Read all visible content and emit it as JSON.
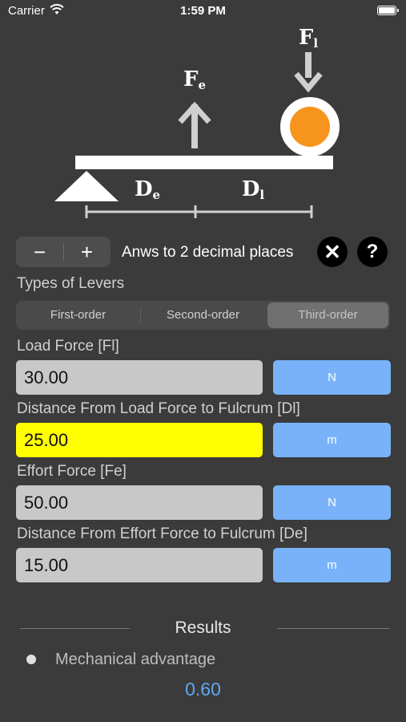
{
  "status_bar": {
    "carrier": "Carrier",
    "time": "1:59 PM"
  },
  "diagram": {
    "load_force_label": "Fl",
    "effort_force_label": "Fe",
    "effort_distance_label": "De",
    "load_distance_label": "Dl"
  },
  "controls": {
    "minus": "−",
    "plus": "+",
    "decimal_label": "Anws to 2 decimal places",
    "clear": "✕",
    "help": "?"
  },
  "lever_types": {
    "title": "Types of Levers",
    "options": [
      "First-order",
      "Second-order",
      "Third-order"
    ],
    "selected": "Third-order"
  },
  "inputs": [
    {
      "label": "Load Force [Fl]",
      "value": "30.00",
      "unit": "N",
      "highlighted": false
    },
    {
      "label": "Distance From Load Force to Fulcrum [Dl]",
      "value": "25.00",
      "unit": "m",
      "highlighted": true
    },
    {
      "label": "Effort Force [Fe]",
      "value": "50.00",
      "unit": "N",
      "highlighted": false
    },
    {
      "label": "Distance From Effort Force to Fulcrum [De]",
      "value": "15.00",
      "unit": "m",
      "highlighted": false
    }
  ],
  "results": {
    "title": "Results",
    "items": [
      {
        "label": "Mechanical advantage",
        "value": "0.60"
      }
    ]
  },
  "colors": {
    "background": "#3b3b3b",
    "unit_button": "#79b2f9",
    "highlight_field": "#ffff00",
    "result_value": "#5ea8f5",
    "load_ball": "#f7941d"
  }
}
